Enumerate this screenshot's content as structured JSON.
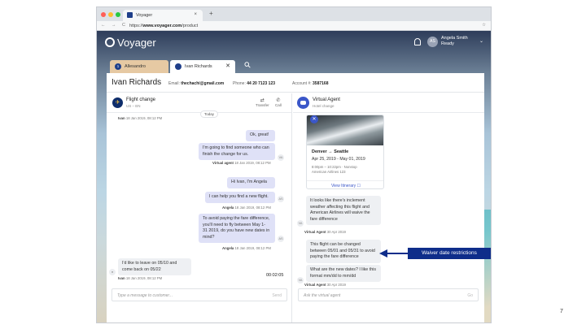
{
  "browser": {
    "tab_title": "Voyager",
    "tab_close": "×",
    "new_tab": "+",
    "nav": "← → C",
    "url_prefix": "https://",
    "url_domain": "www.voyager.com",
    "url_path": "/product",
    "star": "☆"
  },
  "app": {
    "logo": "Voyager",
    "user_initials": "AS",
    "user_name": "Angela Smith",
    "user_status": "Ready",
    "chevron": "⌄"
  },
  "conversation_tabs": [
    {
      "label": "Allesandro",
      "badge": "1",
      "badge_color": "#1f3f8a",
      "color": "#e6c9a3"
    },
    {
      "label": "Ivan Richards",
      "badge": "",
      "badge_color": "#1f3f8a",
      "color": "#ffffff"
    }
  ],
  "tab_close": "✕",
  "search_icon": "⚲",
  "customer": {
    "name": "Ivan Richards",
    "email_label": "Email:",
    "email": "thechachi@gmail.com",
    "phone_label": "Phone:",
    "phone": "44 20 7123 123",
    "account_label": "Account #:",
    "account": "3587168"
  },
  "left_pane": {
    "title": "Flight change",
    "subtitle": "US – EN",
    "transfer_label": "Transfer",
    "transfer_icon": "⇄",
    "call_label": "Call",
    "call_icon": "✆",
    "today": "Today",
    "first_meta_name": "Ivan",
    "first_meta_time": "18 Jan 2019, 08:12 PM",
    "messages": [
      {
        "text": "Ok, great!",
        "side": "agent"
      },
      {
        "text": "I'm going to find someone who can finish the change for us.",
        "side": "agent",
        "meta_name": "Virtual agent",
        "meta_time": "18 Jan 2019, 08:12 PM"
      },
      {
        "text": "Hi Ivan, I'm Angela",
        "side": "agent"
      },
      {
        "text": "I can help you find a new flight.",
        "side": "agent",
        "meta_name": "Angela",
        "meta_time": "18 Jan 2019, 08:12 PM",
        "avatar": "AS"
      },
      {
        "text": "To avoid paying the fare difference, you'll need to fly between May 1- 31 2019, do you have new dates in mind?",
        "side": "agent",
        "meta_name": "Angela",
        "meta_time": "18 Jan 2019, 08:12 PM",
        "avatar": "AS"
      },
      {
        "text": "I'd like to leave on 05/10 and come back on 05/22",
        "side": "customer",
        "meta_name": "Ivan",
        "meta_time": "18 Jan 2019, 08:12 PM"
      }
    ],
    "timer": "00:02:05",
    "composer_placeholder": "Type a message to customer...",
    "send_label": "Send"
  },
  "right_pane": {
    "title": "Virtual Agent",
    "subtitle": "Hotel change",
    "ticket": {
      "close": "✕",
      "route": "Denver → Seattle",
      "dates": "Apr 25, 2019 - May 01, 2019",
      "flight_time": "8:00pm – 10:22pm · Nonstop",
      "airline": "American Airlines 123",
      "itinerary_link": "View Itinerary ☐"
    },
    "messages": [
      {
        "text": "It looks like there's inclement weather affecting this flight and American Airlines will waive the fare difference",
        "meta_name": "Virtual Agent",
        "meta_time": "30 Apr 2019"
      },
      {
        "text": "This flight can be changed between 05/01 and 05/31 to avoid paying the fare difference"
      },
      {
        "text": "What are the new dates? I like this format mm/dd to mm/dd",
        "meta_name": "Virtual Agent",
        "meta_time": "30 Apr 2019"
      }
    ],
    "composer_placeholder": "Ask the virtual agent",
    "go_label": "Go"
  },
  "callout": "Waiver date restrictions",
  "slide_number": "7"
}
